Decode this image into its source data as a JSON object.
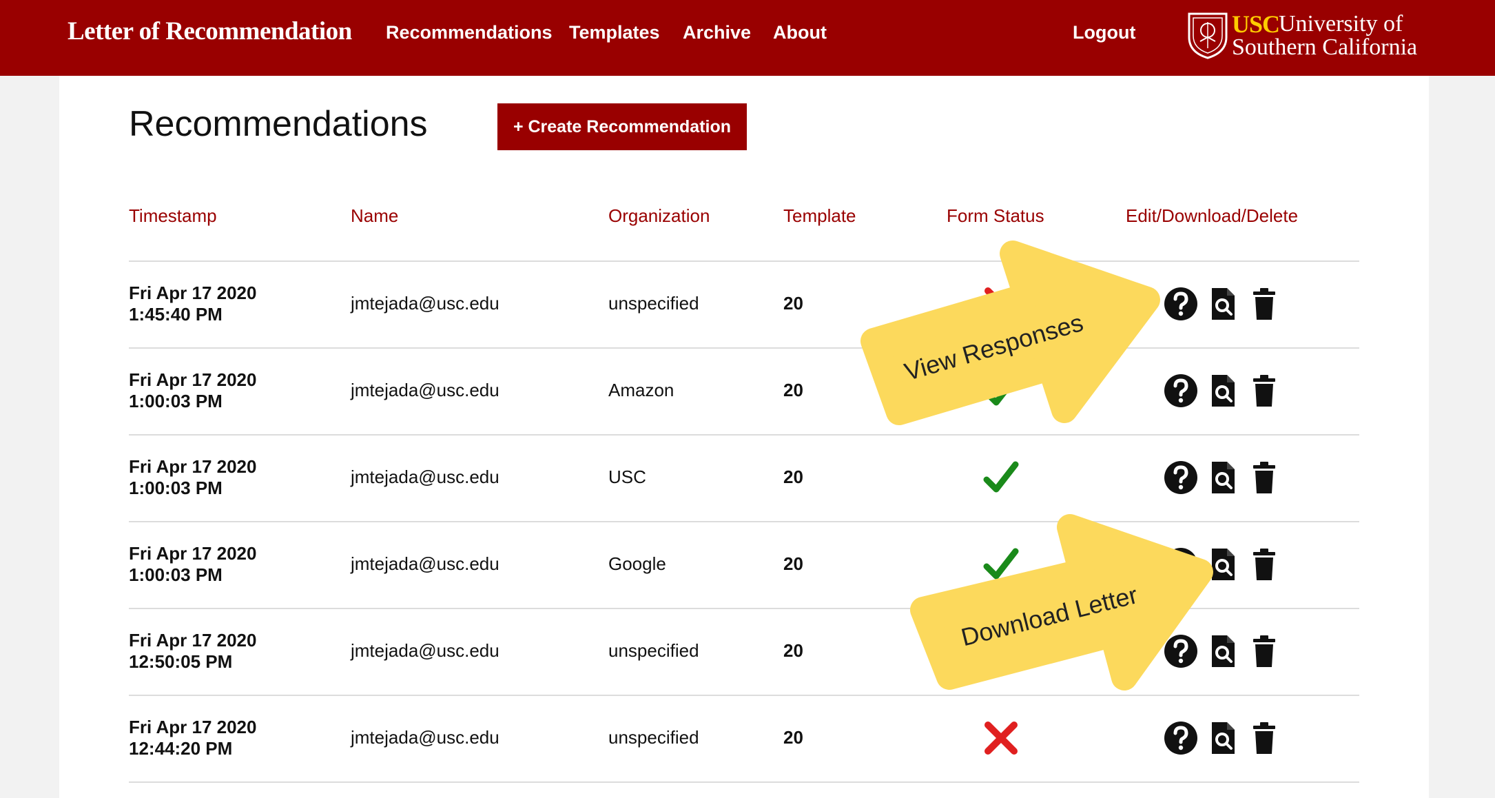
{
  "header": {
    "brand": "Letter of Recommendation",
    "nav": [
      "Recommendations",
      "Templates",
      "Archive",
      "About"
    ],
    "logout": "Logout",
    "logo": {
      "abbr": "USC",
      "line1": "University of",
      "line2": "Southern California"
    }
  },
  "page": {
    "title": "Recommendations",
    "create_button": "+ Create Recommendation"
  },
  "table": {
    "columns": [
      "Timestamp",
      "Name",
      "Organization",
      "Template",
      "Form Status",
      "Edit/Download/Delete"
    ],
    "rows": [
      {
        "date": "Fri Apr 17 2020",
        "time": "1:45:40 PM",
        "name": "jmtejada@usc.edu",
        "organization": "unspecified",
        "template": "20",
        "status": "incomplete"
      },
      {
        "date": "Fri Apr 17 2020",
        "time": "1:00:03 PM",
        "name": "jmtejada@usc.edu",
        "organization": "Amazon",
        "template": "20",
        "status": "complete"
      },
      {
        "date": "Fri Apr 17 2020",
        "time": "1:00:03 PM",
        "name": "jmtejada@usc.edu",
        "organization": "USC",
        "template": "20",
        "status": "complete"
      },
      {
        "date": "Fri Apr 17 2020",
        "time": "1:00:03 PM",
        "name": "jmtejada@usc.edu",
        "organization": "Google",
        "template": "20",
        "status": "complete"
      },
      {
        "date": "Fri Apr 17 2020",
        "time": "12:50:05 PM",
        "name": "jmtejada@usc.edu",
        "organization": "unspecified",
        "template": "20",
        "status": "incomplete"
      },
      {
        "date": "Fri Apr 17 2020",
        "time": "12:44:20 PM",
        "name": "jmtejada@usc.edu",
        "organization": "unspecified",
        "template": "20",
        "status": "incomplete"
      }
    ],
    "action_icons": [
      "question-circle-icon",
      "document-search-icon",
      "trash-icon"
    ]
  },
  "callouts": {
    "view_responses": "View Responses",
    "download_letter": "Download Letter"
  },
  "colors": {
    "brand_red": "#990000",
    "logo_gold": "#ffcc00",
    "check_green": "#1a8a1a",
    "cross_red": "#e02020",
    "callout_yellow": "#fcd95c"
  }
}
